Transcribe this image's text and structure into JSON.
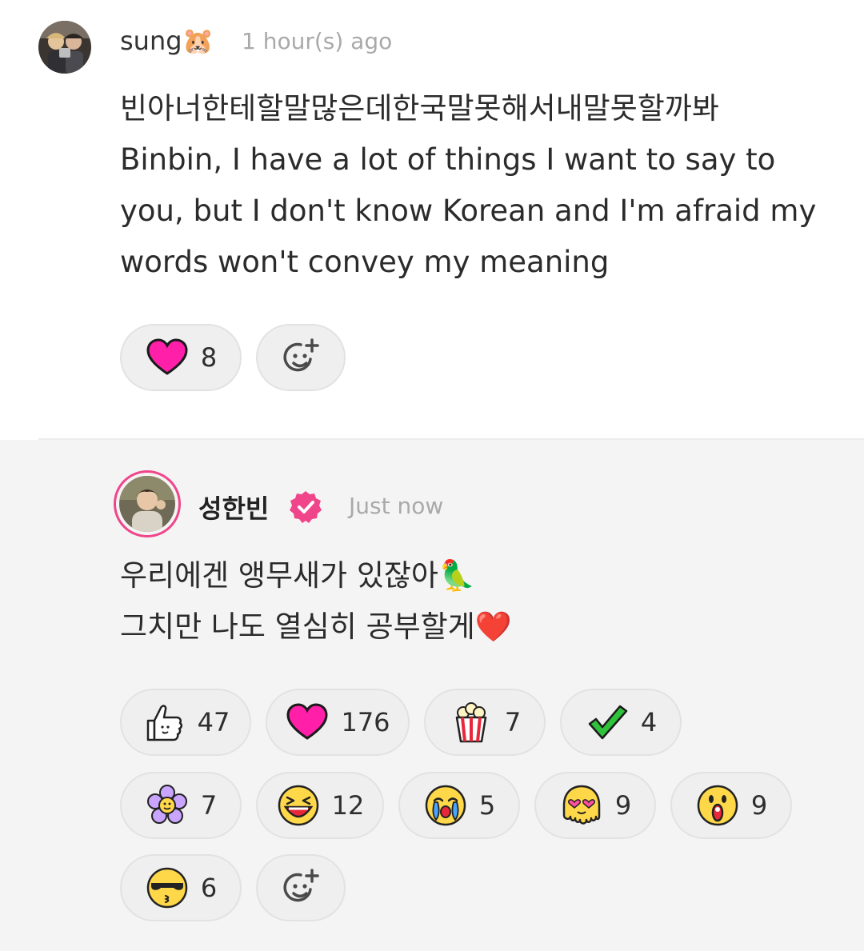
{
  "comment": {
    "author": "sung",
    "author_emoji": "🐹",
    "time": "1 hour(s) ago",
    "lines": [
      "빈아너한테할말많은데한국말못해서내말못할까봐",
      "Binbin, I have a lot of things I want to say to",
      "you, but I don't know Korean and I'm afraid my",
      "words won't convey my meaning"
    ],
    "reactions": [
      {
        "icon": "heart-icon",
        "count": "8"
      }
    ],
    "add_reaction_icon": "add-reaction-icon"
  },
  "reply": {
    "author": "성한빈",
    "verified_icon": "verified-badge-icon",
    "time": "Just now",
    "lines": [
      "우리에겐 앵무새가 있잖아🦜",
      "그치만 나도 열심히 공부할게❤️"
    ],
    "reactions": [
      {
        "icon": "thumbs-up-icon",
        "count": "47"
      },
      {
        "icon": "heart-icon",
        "count": "176"
      },
      {
        "icon": "popcorn-icon",
        "count": "7"
      },
      {
        "icon": "check-icon",
        "count": "4"
      },
      {
        "icon": "flower-icon",
        "count": "7"
      },
      {
        "icon": "laughing-face-icon",
        "count": "12"
      },
      {
        "icon": "crying-face-icon",
        "count": "5"
      },
      {
        "icon": "melting-love-face-icon",
        "count": "9"
      },
      {
        "icon": "shocked-face-icon",
        "count": "9"
      },
      {
        "icon": "sunglasses-kiss-face-icon",
        "count": "6"
      }
    ],
    "add_reaction_icon": "add-reaction-icon"
  },
  "colors": {
    "heart": "#ff1fa9",
    "accent_pink": "#f0458a",
    "timestamp": "#a9a9a9",
    "reply_background": "#f4f4f4"
  }
}
